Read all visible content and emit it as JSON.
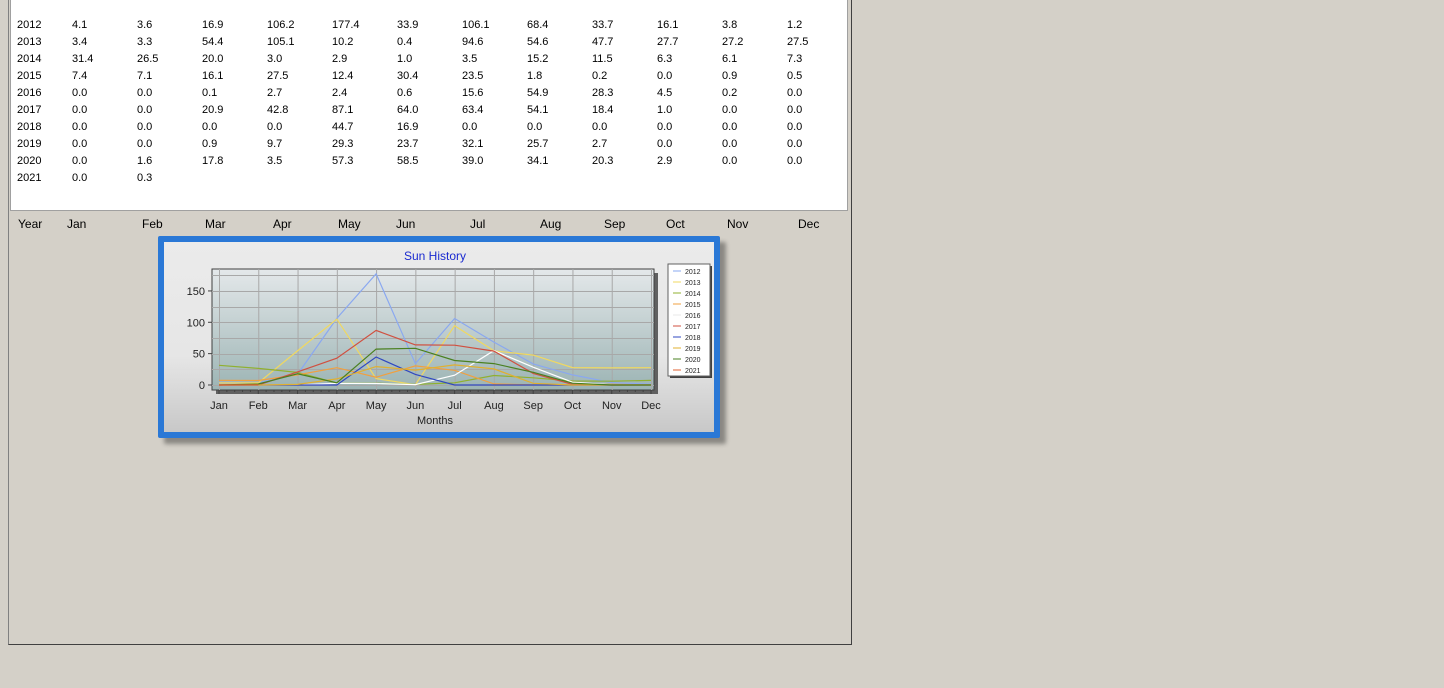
{
  "table": {
    "columns": [
      "Year",
      "Jan",
      "Feb",
      "Mar",
      "Apr",
      "May",
      "Jun",
      "Jul",
      "Aug",
      "Sep",
      "Oct",
      "Nov",
      "Dec"
    ],
    "rows": [
      [
        "2012",
        "4.1",
        "3.6",
        "16.9",
        "106.2",
        "177.4",
        "33.9",
        "106.1",
        "68.4",
        "33.7",
        "16.1",
        "3.8",
        "1.2"
      ],
      [
        "2013",
        "3.4",
        "3.3",
        "54.4",
        "105.1",
        "10.2",
        "0.4",
        "94.6",
        "54.6",
        "47.7",
        "27.7",
        "27.2",
        "27.5"
      ],
      [
        "2014",
        "31.4",
        "26.5",
        "20.0",
        "3.0",
        "2.9",
        "1.0",
        "3.5",
        "15.2",
        "11.5",
        "6.3",
        "6.1",
        "7.3"
      ],
      [
        "2015",
        "7.4",
        "7.1",
        "16.1",
        "27.5",
        "12.4",
        "30.4",
        "23.5",
        "1.8",
        "0.2",
        "0.0",
        "0.9",
        "0.5"
      ],
      [
        "2016",
        "0.0",
        "0.0",
        "0.1",
        "2.7",
        "2.4",
        "0.6",
        "15.6",
        "54.9",
        "28.3",
        "4.5",
        "0.2",
        "0.0"
      ],
      [
        "2017",
        "0.0",
        "0.0",
        "20.9",
        "42.8",
        "87.1",
        "64.0",
        "63.4",
        "54.1",
        "18.4",
        "1.0",
        "0.0",
        "0.0"
      ],
      [
        "2018",
        "0.0",
        "0.0",
        "0.0",
        "0.0",
        "44.7",
        "16.9",
        "0.0",
        "0.0",
        "0.0",
        "0.0",
        "0.0",
        "0.0"
      ],
      [
        "2019",
        "0.0",
        "0.0",
        "0.9",
        "9.7",
        "29.3",
        "23.7",
        "32.1",
        "25.7",
        "2.7",
        "0.0",
        "0.0",
        "0.0"
      ],
      [
        "2020",
        "0.0",
        "1.6",
        "17.8",
        "3.5",
        "57.3",
        "58.5",
        "39.0",
        "34.1",
        "20.3",
        "2.9",
        "0.0",
        "0.0"
      ],
      [
        "2021",
        "0.0",
        "0.3"
      ]
    ]
  },
  "chart_data": {
    "type": "line",
    "title": "Sun History",
    "xlabel": "Months",
    "ylabel": "",
    "categories": [
      "Jan",
      "Feb",
      "Mar",
      "Apr",
      "May",
      "Jun",
      "Jul",
      "Aug",
      "Sep",
      "Oct",
      "Nov",
      "Dec"
    ],
    "yticks": [
      0,
      50,
      100,
      150
    ],
    "ylim": [
      -8,
      185
    ],
    "grid": true,
    "legend": "right",
    "series": [
      {
        "name": "2012",
        "color": "#8aa8f0",
        "values": [
          4.1,
          3.6,
          16.9,
          106.2,
          177.4,
          33.9,
          106.1,
          68.4,
          33.7,
          16.1,
          3.8,
          1.2
        ]
      },
      {
        "name": "2013",
        "color": "#f0d860",
        "values": [
          3.4,
          3.3,
          54.4,
          105.1,
          10.2,
          0.4,
          94.6,
          54.6,
          47.7,
          27.7,
          27.2,
          27.5
        ]
      },
      {
        "name": "2014",
        "color": "#90b030",
        "values": [
          31.4,
          26.5,
          20.0,
          3.0,
          2.9,
          1.0,
          3.5,
          15.2,
          11.5,
          6.3,
          6.1,
          7.3
        ]
      },
      {
        "name": "2015",
        "color": "#f0a040",
        "values": [
          7.4,
          7.1,
          16.1,
          27.5,
          12.4,
          30.4,
          23.5,
          1.8,
          0.2,
          0.0,
          0.9,
          0.5
        ]
      },
      {
        "name": "2016",
        "color": "#ffffff",
        "values": [
          0.0,
          0.0,
          0.1,
          2.7,
          2.4,
          0.6,
          15.6,
          54.9,
          28.3,
          4.5,
          0.2,
          0.0
        ]
      },
      {
        "name": "2017",
        "color": "#d05040",
        "values": [
          0.0,
          0.0,
          20.9,
          42.8,
          87.1,
          64.0,
          63.4,
          54.1,
          18.4,
          1.0,
          0.0,
          0.0
        ]
      },
      {
        "name": "2018",
        "color": "#3048c0",
        "values": [
          0.0,
          0.0,
          0.0,
          0.0,
          44.7,
          16.9,
          0.0,
          0.0,
          0.0,
          0.0,
          0.0,
          0.0
        ]
      },
      {
        "name": "2019",
        "color": "#e0b030",
        "values": [
          0.0,
          0.0,
          0.9,
          9.7,
          29.3,
          23.7,
          32.1,
          25.7,
          2.7,
          0.0,
          0.0,
          0.0
        ]
      },
      {
        "name": "2020",
        "color": "#4a8020",
        "values": [
          0.0,
          1.6,
          17.8,
          3.5,
          57.3,
          58.5,
          39.0,
          34.1,
          20.3,
          2.9,
          0.0,
          0.0
        ]
      },
      {
        "name": "2021",
        "color": "#e06030",
        "values": [
          0.0,
          0.3
        ]
      }
    ]
  },
  "colors": {
    "frame": "#2a78d6",
    "title": "#1a2ad0"
  }
}
